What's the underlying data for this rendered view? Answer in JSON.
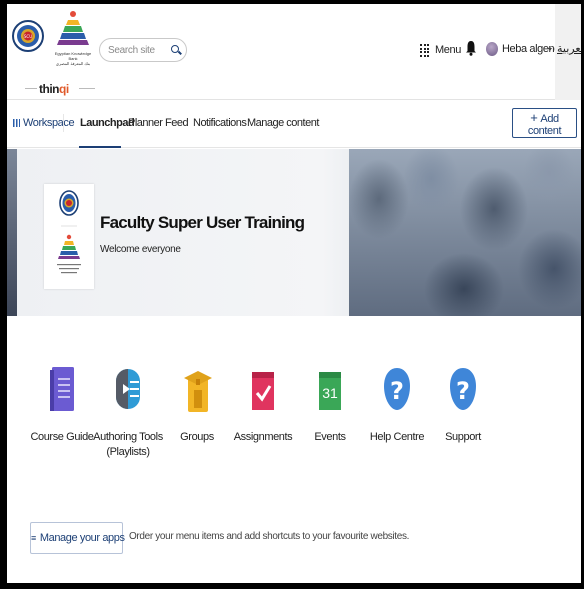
{
  "header": {
    "seal_text": "SCU",
    "ekb_name_en": "Egyptian Knowledge Bank",
    "ekb_name_ar": "بنك المعرفة المصري",
    "thinqi_prefix": "thin",
    "thinqi_suffix": "qi",
    "search_placeholder": "Search site",
    "menu_label": "Menu",
    "user_name": "Heba algendy",
    "language_link": "العربية"
  },
  "nav": {
    "workspace_label": "Workspace",
    "tabs": [
      {
        "label": "Launchpad"
      },
      {
        "label": "Planner"
      },
      {
        "label": "Feed"
      },
      {
        "label": "Notifications"
      },
      {
        "label": "Manage content"
      }
    ],
    "add_content_label": "Add content"
  },
  "banner": {
    "title": "Faculty Super User Training",
    "subtitle": "Welcome everyone"
  },
  "apps": [
    {
      "label": "Course Guide",
      "icon": "book-icon"
    },
    {
      "label": "Authoring Tools (Playlists)",
      "icon": "playlist-icon"
    },
    {
      "label": "Groups",
      "icon": "graduation-cap-icon"
    },
    {
      "label": "Assignments",
      "icon": "checkmark-icon"
    },
    {
      "label": "Events",
      "icon": "calendar-icon",
      "calendar_day": "31"
    },
    {
      "label": "Help Centre",
      "icon": "help-icon"
    },
    {
      "label": "Support",
      "icon": "help-icon"
    }
  ],
  "manage": {
    "button_label": "Manage your apps",
    "description": "Order your menu items and add shortcuts to your favourite websites."
  },
  "colors": {
    "brand_navy": "#1c3f75",
    "accent_orange": "#e05a2a",
    "help_blue": "#3f86d8",
    "assignments_pink": "#e0345f",
    "events_green": "#3aa757"
  }
}
